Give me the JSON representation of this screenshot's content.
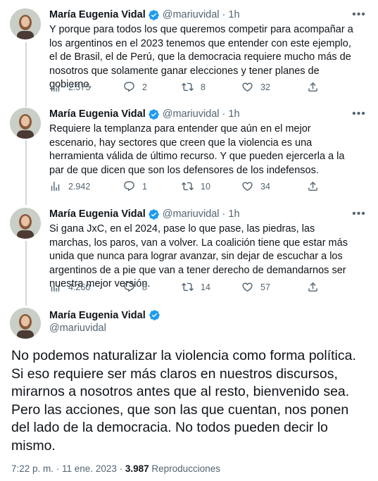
{
  "author": {
    "name": "María Eugenia Vidal",
    "handle": "@mariuvidal"
  },
  "tweets": [
    {
      "time": "1h",
      "text": "Y porque para todos los que queremos competir para acompañar a los argentinos en el 2023 tenemos que entender con este ejemplo, el de Brasil, el de Perú, que la democracia requiere mucho más de nosotros que solamente ganar elecciones y tener planes de gobierno.",
      "views": "2.575",
      "replies": "2",
      "retweets": "8",
      "likes": "32"
    },
    {
      "time": "1h",
      "text": "Requiere la templanza para entender que aún en el mejor escenario, hay sectores que creen que la violencia es una herramienta válida de último recurso. Y que pueden ejercerla a la par de que dicen que son los defensores de los indefensos.",
      "views": "2.942",
      "replies": "1",
      "retweets": "10",
      "likes": "34"
    },
    {
      "time": "1h",
      "text": "Si gana JxC, en el 2024, pase lo que pase, las piedras, las marchas, los paros, van a volver. La coalición tiene que estar más unida que nunca para lograr avanzar, sin dejar de escuchar a los argentinos de a pie que van a tener derecho de demandarnos ser nuestra mejor versión.",
      "views": "4.260",
      "replies": "8",
      "retweets": "14",
      "likes": "57"
    }
  ],
  "main_tweet": {
    "text": "No podemos naturalizar la violencia como forma política. Si eso requiere ser más claros en nuestros discursos, mirarnos a nosotros antes que al resto, bienvenido sea. Pero las acciones, que son las que cuentan, nos ponen del lado de la democracia. No todos pueden decir lo mismo.",
    "timestamp": "7:22 p. m. · 11 ene. 2023 · ",
    "views_count": "3.987",
    "views_label": " Reproducciones"
  },
  "colors": {
    "verified": "#1d9bf0",
    "secondary": "#536471",
    "line": "#cfd9de"
  },
  "icons": [
    "verified-badge-icon",
    "more-icon",
    "views-icon",
    "reply-icon",
    "retweet-icon",
    "like-icon",
    "share-icon"
  ]
}
